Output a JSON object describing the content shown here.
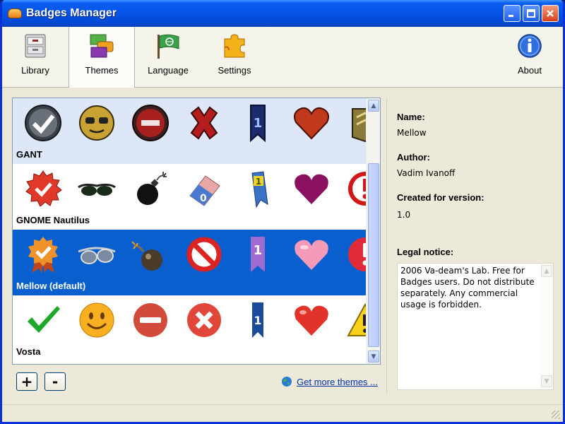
{
  "window": {
    "title": "Badges Manager",
    "controls": [
      "minimize",
      "maximize",
      "close"
    ]
  },
  "toolbar": {
    "items": [
      {
        "label": "Library",
        "icon": "library-cabinet-icon",
        "active": false
      },
      {
        "label": "Themes",
        "icon": "themes-layers-icon",
        "active": true
      },
      {
        "label": "Language",
        "icon": "language-flag-icon",
        "active": false
      },
      {
        "label": "Settings",
        "icon": "settings-puzzle-icon",
        "active": false
      }
    ],
    "about": {
      "label": "About",
      "icon": "info-icon"
    }
  },
  "themes": [
    {
      "name": "GANT",
      "selected": false,
      "icons": [
        "check-icon",
        "smiley-icon",
        "minus-icon",
        "x-icon",
        "ribbon-1-icon",
        "heart-icon",
        "rank-icon"
      ]
    },
    {
      "name": "GNOME Nautilus",
      "selected": false,
      "icons": [
        "check-seal-icon",
        "sunglasses-icon",
        "bomb-icon",
        "eraser-icon",
        "ribbon-1-icon",
        "heart-icon",
        "exclamation-icon"
      ]
    },
    {
      "name": "Mellow (default)",
      "selected": true,
      "icons": [
        "award-medal-icon",
        "sunglasses-icon",
        "bomb-icon",
        "no-entry-icon",
        "ribbon-1-icon",
        "heart-icon",
        "exclamation-icon"
      ]
    },
    {
      "name": "Vosta",
      "selected": false,
      "icons": [
        "check-icon",
        "smiley-icon",
        "minus-icon",
        "x-icon",
        "ribbon-1-icon",
        "heart-icon",
        "warning-icon"
      ]
    }
  ],
  "list_actions": {
    "add": "+",
    "remove": "-",
    "more_link": "Get more themes ..."
  },
  "details": {
    "name_label": "Name:",
    "name_value": "Mellow",
    "author_label": "Author:",
    "author_value": "Vadim Ivanoff",
    "version_label": "Created for version:",
    "version_value": "1.0",
    "legal_label": "Legal notice:",
    "legal_lines": [
      "2006 Va-deam's Lab. Free for",
      "Badges users. Do not distribute",
      "separately. Any commercial",
      "usage is forbidden."
    ]
  },
  "colors": {
    "title_bar": "#0553e6",
    "selection": "#0a5fcf",
    "first_row": "#dde7f7",
    "link": "#0033aa"
  }
}
